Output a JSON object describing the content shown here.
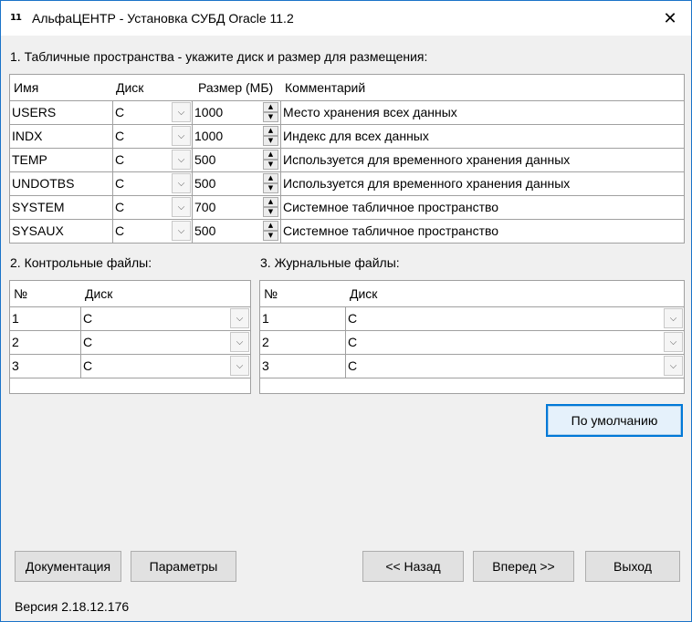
{
  "window": {
    "icon_text": "11",
    "title": "АльфаЦЕНТР - Установка СУБД Oracle 11.2",
    "close_glyph": "✕"
  },
  "section1": {
    "label": "1. Табличные пространства - укажите диск и размер для размещения:",
    "columns": [
      "Имя",
      "Диск",
      "Размер (МБ)",
      "Комментарий"
    ],
    "rows": [
      {
        "name": "USERS",
        "disk": "C",
        "size": "1000",
        "comment": "Место хранения всех данных"
      },
      {
        "name": "INDX",
        "disk": "C",
        "size": "1000",
        "comment": "Индекс для всех данных"
      },
      {
        "name": "TEMP",
        "disk": "C",
        "size": "500",
        "comment": "Используется для временного хранения данных"
      },
      {
        "name": "UNDOTBS",
        "disk": "C",
        "size": "500",
        "comment": "Используется для временного хранения данных"
      },
      {
        "name": "SYSTEM",
        "disk": "C",
        "size": "700",
        "comment": "Системное табличное пространство"
      },
      {
        "name": "SYSAUX",
        "disk": "C",
        "size": "500",
        "comment": "Системное табличное пространство"
      }
    ]
  },
  "section2": {
    "label": "2. Контрольные файлы:",
    "columns": [
      "№",
      "Диск"
    ],
    "rows": [
      {
        "num": "1",
        "disk": "C"
      },
      {
        "num": "2",
        "disk": "C"
      },
      {
        "num": "3",
        "disk": "C"
      }
    ]
  },
  "section3": {
    "label": "3. Журнальные файлы:",
    "columns": [
      "№",
      "Диск"
    ],
    "rows": [
      {
        "num": "1",
        "disk": "C"
      },
      {
        "num": "2",
        "disk": "C"
      },
      {
        "num": "3",
        "disk": "C"
      }
    ]
  },
  "buttons": {
    "defaults": "По умолчанию",
    "docs": "Документация",
    "params": "Параметры",
    "back": "<< Назад",
    "next": "Вперед >>",
    "exit": "Выход"
  },
  "glyphs": {
    "combo": "⌵",
    "spin_up": "▲",
    "spin_down": "▼"
  },
  "version": "Версия 2.18.12.176"
}
